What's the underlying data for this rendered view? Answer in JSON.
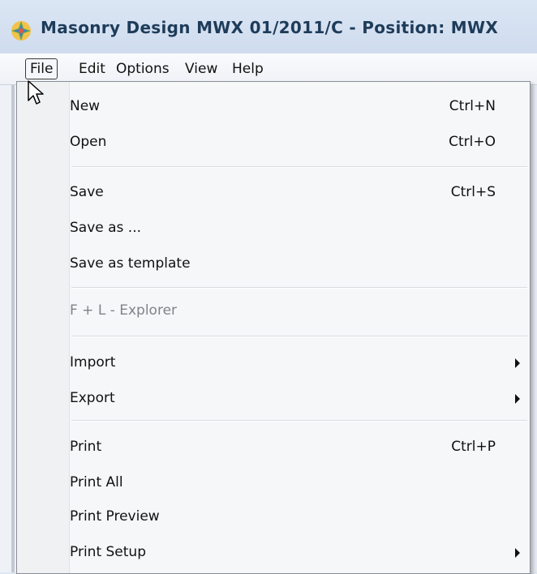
{
  "window": {
    "title": "Masonry Design MWX 01/2011/C - Position: MWX"
  },
  "menubar": {
    "items": [
      "File",
      "Edit",
      "Options",
      "View",
      "Help"
    ]
  },
  "file_menu": {
    "items": [
      {
        "label": "New",
        "shortcut": "Ctrl+N"
      },
      {
        "label": "Open",
        "shortcut": "Ctrl+O"
      },
      {
        "label": "Save",
        "shortcut": "Ctrl+S"
      },
      {
        "label": "Save as ...",
        "shortcut": ""
      },
      {
        "label": "Save as template",
        "shortcut": ""
      },
      {
        "label": "F + L - Explorer",
        "shortcut": "",
        "disabled": true
      },
      {
        "label": "Import",
        "submenu": true
      },
      {
        "label": "Export",
        "submenu": true
      },
      {
        "label": "Print",
        "shortcut": "Ctrl+P"
      },
      {
        "label": "Print All",
        "shortcut": ""
      },
      {
        "label": "Print Preview",
        "shortcut": ""
      },
      {
        "label": "Print Setup",
        "submenu": true
      }
    ]
  },
  "icons": {
    "app": "app-logo-icon",
    "cursor": "mouse-pointer-icon",
    "submenu": "submenu-arrow-icon"
  }
}
